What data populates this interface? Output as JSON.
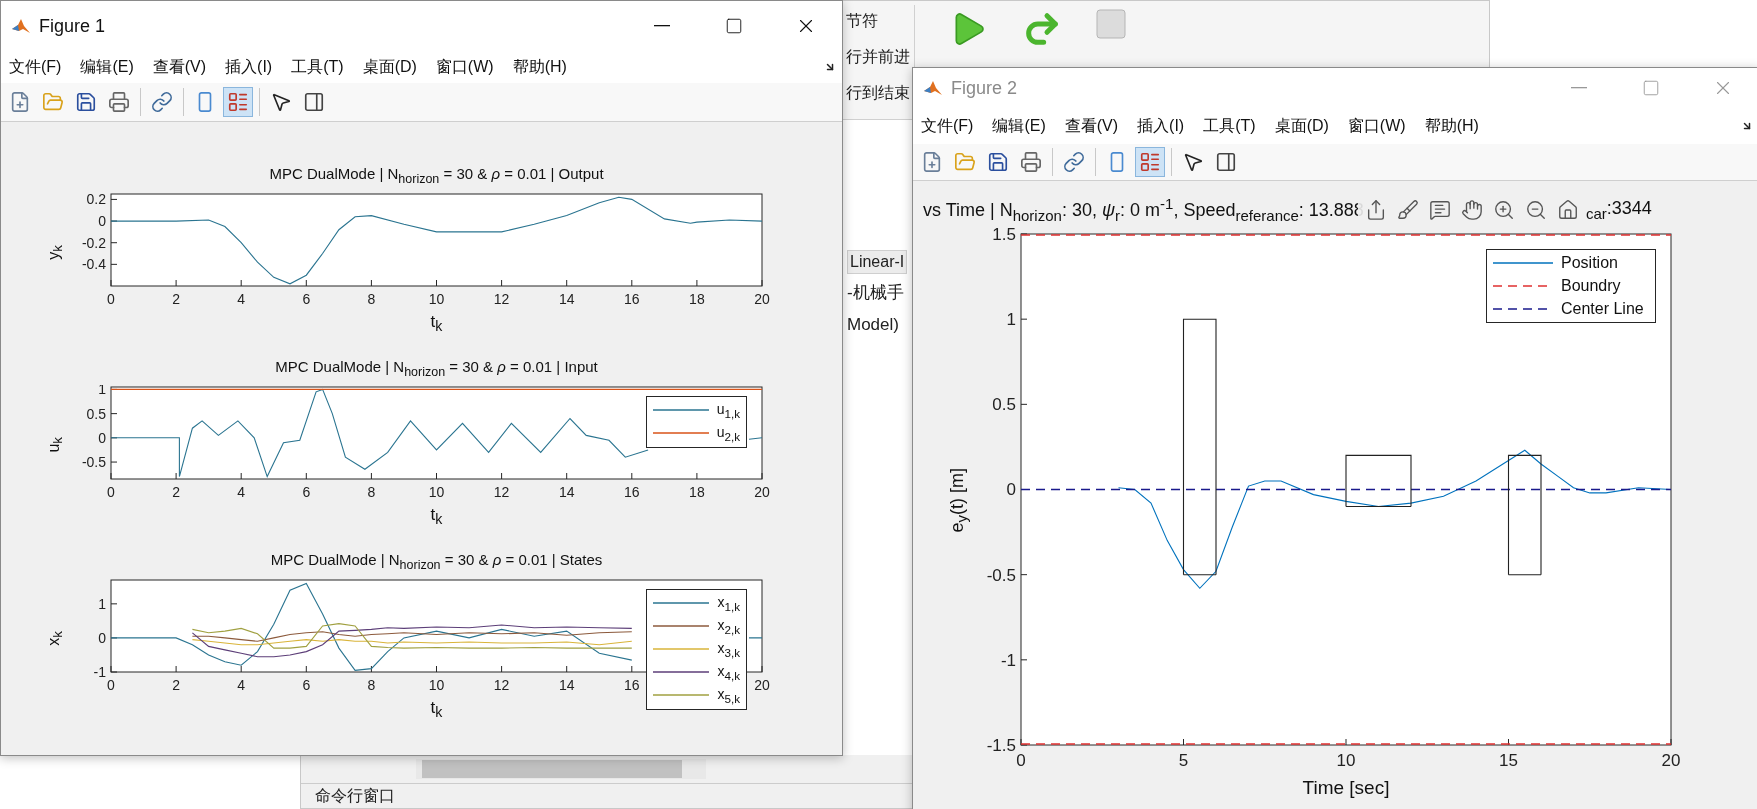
{
  "background_window": {
    "toolstrip_items": [
      "节符",
      "行并前进",
      "行到结束"
    ],
    "editor_tab": "Linear-I",
    "editor_lines": [
      "-机械手",
      "Model)"
    ],
    "command_window_title": "命令行窗口"
  },
  "figure_1": {
    "title": "Figure 1",
    "active": true,
    "menu": [
      "文件(F)",
      "编辑(E)",
      "查看(V)",
      "插入(I)",
      "工具(T)",
      "桌面(D)",
      "窗口(W)",
      "帮助(H)"
    ],
    "toolbar": [
      {
        "kind": "new",
        "selected": false
      },
      {
        "kind": "open",
        "selected": false
      },
      {
        "kind": "save",
        "selected": false
      },
      {
        "kind": "print",
        "selected": false
      },
      {
        "kind": "separator"
      },
      {
        "kind": "link",
        "selected": false
      },
      {
        "kind": "separator"
      },
      {
        "kind": "colorbar",
        "selected": false
      },
      {
        "kind": "legend",
        "selected": true
      },
      {
        "kind": "separator"
      },
      {
        "kind": "pointer",
        "selected": false
      },
      {
        "kind": "inspector",
        "selected": false
      }
    ],
    "plots": [
      {
        "chart_data": {
          "type": "line",
          "title": "MPC DualMode | N$_{horizon}$ = 30 & *ρ* = 0.01 | Output",
          "xlabel": "t$_{k}$",
          "ylabel": "y$_{k}$",
          "xlim": [
            0,
            20
          ],
          "ylim": [
            -0.6,
            0.25
          ],
          "xticks": [
            0,
            2,
            4,
            6,
            8,
            10,
            12,
            14,
            16,
            18,
            20
          ],
          "yticks": [
            -0.4,
            -0.2,
            0,
            0.2
          ],
          "x": [
            0,
            1,
            2,
            3,
            3.5,
            4,
            4.5,
            5,
            5.5,
            6,
            6.5,
            7,
            7.5,
            8,
            9,
            10,
            11,
            12,
            13,
            14,
            15,
            15.6,
            16,
            17,
            17.8,
            18,
            19,
            20
          ],
          "series": [
            {
              "color": "#2a7490",
              "values": [
                0,
                0,
                0,
                0.01,
                -0.05,
                -0.2,
                -0.38,
                -0.52,
                -0.58,
                -0.5,
                -0.3,
                -0.08,
                0.04,
                0.05,
                -0.03,
                -0.1,
                -0.1,
                -0.1,
                -0.03,
                0.05,
                0.17,
                0.22,
                0.2,
                0.02,
                -0.02,
                -0.01,
                0.01,
                0
              ]
            }
          ]
        }
      },
      {
        "chart_data": {
          "type": "line",
          "title": "MPC DualMode | N$_{horizon}$ = 30 & *ρ* = 0.01 | Input",
          "xlabel": "t$_{k}$",
          "ylabel": "u$_{k}$",
          "xlim": [
            0,
            20
          ],
          "ylim": [
            -0.85,
            1.05
          ],
          "xticks": [
            0,
            2,
            4,
            6,
            8,
            10,
            12,
            14,
            16,
            18,
            20
          ],
          "yticks": [
            -0.5,
            0,
            0.5,
            1
          ],
          "x": [
            0,
            2.1,
            2.1,
            2.5,
            2.8,
            3.3,
            3.9,
            4.4,
            4.8,
            5.3,
            5.8,
            6.3,
            6.5,
            6.8,
            7.2,
            7.8,
            8.5,
            9.2,
            10,
            10.8,
            11.6,
            12.3,
            13.2,
            14.1,
            14.6,
            15.3,
            15.8,
            16.5,
            17.5,
            19.6,
            20
          ],
          "series": [
            {
              "name": "u$_{1,k}$",
              "color": "#2a7490",
              "values": [
                0,
                0,
                -0.8,
                0.2,
                0.35,
                0.05,
                0.35,
                0,
                -0.8,
                -0.1,
                -0.05,
                0.95,
                1,
                0.5,
                -0.4,
                -0.65,
                -0.3,
                0.35,
                -0.25,
                0.3,
                -0.3,
                0.3,
                -0.3,
                0.4,
                0.05,
                -0.05,
                -0.4,
                -0.25,
                null,
                -0.03,
                0
              ]
            },
            {
              "name": "u$_{2,k}$",
              "color": "#d95319",
              "values": [
                1,
                1,
                1,
                1,
                1,
                1,
                1,
                1,
                1,
                1,
                1,
                1,
                1,
                1,
                1,
                1,
                1,
                1,
                1,
                1,
                1,
                1,
                1,
                1,
                1,
                1,
                1,
                1,
                1,
                1,
                1
              ]
            }
          ]
        }
      },
      {
        "chart_data": {
          "type": "line",
          "title": "MPC DualMode | N$_{horizon}$ = 30 & *ρ* = 0.01 | States",
          "xlabel": "t$_{k}$",
          "ylabel": "x$_{k}$",
          "xlim": [
            0,
            20
          ],
          "ylim": [
            -1,
            1.7
          ],
          "xticks": [
            0,
            2,
            4,
            6,
            8,
            10,
            12,
            14,
            16,
            20
          ],
          "yticks": [
            -1,
            0,
            1
          ],
          "x": [
            0,
            2,
            2.5,
            3,
            3.5,
            4,
            4.5,
            5,
            5.5,
            6,
            6.5,
            7,
            7.5,
            8,
            8.5,
            9,
            10,
            11,
            12,
            13,
            14,
            15,
            16,
            17,
            18,
            19.6,
            20
          ],
          "series": [
            {
              "name": "x$_{1,k}$",
              "color": "#2a7490",
              "values": [
                0,
                0,
                -0.2,
                -0.5,
                -0.7,
                -0.8,
                -0.4,
                0.4,
                1.4,
                1.6,
                0.7,
                -0.3,
                -0.95,
                -0.9,
                -0.4,
                0,
                0.2,
                0,
                0.25,
                0.05,
                0.2,
                -0.45,
                -0.65,
                null,
                null,
                0,
                0
              ]
            },
            {
              "name": "x$_{2,k}$",
              "color": "#8c5a3c",
              "values": [
                null,
                null,
                0.05,
                0.05,
                0,
                -0.05,
                -0.1,
                0,
                0.1,
                0.15,
                0.18,
                0.1,
                0.05,
                0.1,
                0.12,
                0.15,
                0.1,
                0.15,
                0.12,
                0.15,
                0.08,
                0.15,
                0.18,
                null,
                null,
                null,
                null
              ]
            },
            {
              "name": "x$_{3,k}$",
              "color": "#d9b43a",
              "values": [
                null,
                null,
                -0.05,
                -0.1,
                -0.15,
                -0.2,
                -0.2,
                -0.15,
                -0.1,
                -0.05,
                -0.1,
                -0.05,
                -0.1,
                -0.1,
                -0.15,
                -0.12,
                -0.15,
                -0.12,
                -0.15,
                -0.15,
                -0.12,
                -0.2,
                -0.1,
                null,
                null,
                null,
                null
              ]
            },
            {
              "name": "x$_{4,k}$",
              "color": "#5c3e78",
              "values": [
                null,
                null,
                0.15,
                -0.25,
                -0.35,
                -0.45,
                -0.55,
                -0.55,
                -0.5,
                -0.4,
                -0.2,
                0.2,
                0.22,
                0.25,
                0.3,
                0.28,
                0.32,
                0.3,
                0.38,
                0.3,
                0.32,
                0.3,
                0.28,
                null,
                null,
                null,
                null
              ]
            },
            {
              "name": "x$_{5,k}$",
              "color": "#a0a040",
              "values": [
                null,
                null,
                0.25,
                0.15,
                0.2,
                0.28,
                0.12,
                -0.3,
                -0.3,
                -0.25,
                0.35,
                0.42,
                0.35,
                -0.25,
                -0.28,
                -0.3,
                -0.28,
                -0.3,
                -0.3,
                -0.28,
                -0.3,
                -0.3,
                -0.3,
                null,
                null,
                null,
                null
              ]
            }
          ]
        }
      }
    ]
  },
  "figure_2": {
    "title": "Figure 2",
    "active": false,
    "menu": [
      "文件(F)",
      "编辑(E)",
      "查看(V)",
      "插入(I)",
      "工具(T)",
      "桌面(D)",
      "窗口(W)",
      "帮助(H)"
    ],
    "toolbar": [
      {
        "kind": "new",
        "selected": false
      },
      {
        "kind": "open",
        "selected": false
      },
      {
        "kind": "save",
        "selected": false
      },
      {
        "kind": "print",
        "selected": false
      },
      {
        "kind": "separator"
      },
      {
        "kind": "link",
        "selected": false
      },
      {
        "kind": "separator"
      },
      {
        "kind": "colorbar",
        "selected": false
      },
      {
        "kind": "legend",
        "selected": true
      },
      {
        "kind": "separator"
      },
      {
        "kind": "pointer",
        "selected": false
      },
      {
        "kind": "inspector",
        "selected": false
      }
    ],
    "title_left": "vs Time | N$_{horizon}$: 30, *ψ*$_{r}$: 0 m$^{-1}$, Speed$_{referance}$: 13.888",
    "title_right": "$_{car}$:3344",
    "axes_toolbar": [
      {
        "kind": "export"
      },
      {
        "kind": "brush"
      },
      {
        "kind": "datatip"
      },
      {
        "kind": "pan"
      },
      {
        "kind": "zoom-in"
      },
      {
        "kind": "zoom-out"
      },
      {
        "kind": "home"
      }
    ],
    "plot": {
      "chart_data": {
        "type": "line",
        "xlabel": "Time [sec]",
        "ylabel": "e$_{y}$(t) [m]",
        "xlim": [
          0,
          20
        ],
        "ylim": [
          -1.5,
          1.5
        ],
        "xticks": [
          0,
          5,
          10,
          15,
          20
        ],
        "yticks": [
          -1.5,
          -1,
          -0.5,
          0,
          0.5,
          1,
          1.5
        ],
        "x": [
          0,
          1,
          2,
          3,
          3.5,
          4,
          4.5,
          5,
          5,
          5.5,
          6,
          6,
          6.5,
          7,
          7.5,
          8,
          9,
          10,
          10,
          11,
          12,
          12,
          13,
          14,
          15,
          15,
          15.5,
          16,
          16,
          16.5,
          17,
          17.5,
          18,
          19,
          20
        ],
        "series": [
          {
            "name": "Position",
            "color": "#0072bd",
            "line_style": "solid",
            "values": [
              null,
              null,
              null,
              0.01,
              0,
              -0.08,
              -0.3,
              -0.47,
              -0.47,
              -0.58,
              -0.48,
              -0.48,
              -0.22,
              0.02,
              0.05,
              0.05,
              -0.03,
              -0.07,
              -0.07,
              -0.1,
              -0.08,
              -0.08,
              -0.04,
              0.05,
              0.17,
              0.17,
              0.23,
              0.15,
              0.15,
              0.08,
              0.01,
              -0.02,
              -0.02,
              0.01,
              0
            ]
          },
          {
            "name": "Boundry",
            "color": "#e03030",
            "line_style": "dashed",
            "values": [
              1.5,
              1.5,
              1.5,
              1.5,
              1.5,
              1.5,
              1.5,
              1.5,
              1.5,
              1.5,
              1.5,
              1.5,
              1.5,
              1.5,
              1.5,
              1.5,
              1.5,
              1.5,
              1.5,
              1.5,
              1.5,
              1.5,
              1.5,
              1.5,
              1.5,
              1.5,
              1.5,
              1.5,
              1.5,
              1.5,
              1.5,
              1.5,
              1.5,
              1.5,
              1.5
            ]
          },
          {
            "name": "Center Line",
            "color": "#1a1a8c",
            "line_style": "dashed",
            "values": [
              0,
              0,
              0,
              0,
              0,
              0,
              0,
              0,
              0,
              0,
              0,
              0,
              0,
              0,
              0,
              0,
              0,
              0,
              0,
              0,
              0,
              0,
              0,
              0,
              0,
              0,
              0,
              0,
              0,
              0,
              0,
              0,
              0,
              0,
              0
            ]
          },
          {
            "color": "#222222",
            "line_style": "solid",
            "values": [
              null,
              null,
              null,
              null,
              null,
              null,
              null,
              -0.5,
              1,
              1,
              1,
              -0.5,
              null,
              null,
              null,
              null,
              null,
              null,
              null,
              null,
              null,
              null,
              null,
              null,
              null,
              null,
              null,
              null,
              null,
              null,
              null,
              null,
              null,
              null,
              null
            ]
          },
          {
            "color": "#222222",
            "line_style": "solid",
            "values": [
              null,
              null,
              null,
              null,
              null,
              null,
              null,
              -0.5,
              -0.5,
              -0.5,
              -0.5,
              -0.5,
              null,
              null,
              null,
              null,
              null,
              null,
              null,
              null,
              null,
              null,
              null,
              null,
              null,
              null,
              null,
              null,
              null,
              null,
              null,
              null,
              null,
              null,
              null
            ]
          },
          {
            "color": "#222222",
            "line_style": "solid",
            "values": [
              null,
              null,
              null,
              null,
              null,
              null,
              null,
              null,
              null,
              null,
              null,
              null,
              null,
              null,
              null,
              null,
              null,
              -0.1,
              0.2,
              0.2,
              0.2,
              -0.1,
              null,
              null,
              null,
              null,
              null,
              null,
              null,
              null,
              null,
              null,
              null,
              null,
              null
            ]
          },
          {
            "color": "#222222",
            "line_style": "solid",
            "values": [
              null,
              null,
              null,
              null,
              null,
              null,
              null,
              null,
              null,
              null,
              null,
              null,
              null,
              null,
              null,
              null,
              null,
              -0.1,
              -0.1,
              -0.1,
              -0.1,
              -0.1,
              null,
              null,
              null,
              null,
              null,
              null,
              null,
              null,
              null,
              null,
              null,
              null,
              null
            ]
          },
          {
            "color": "#222222",
            "line_style": "solid",
            "values": [
              null,
              null,
              null,
              null,
              null,
              null,
              null,
              null,
              null,
              null,
              null,
              null,
              null,
              null,
              null,
              null,
              null,
              null,
              null,
              null,
              null,
              null,
              null,
              null,
              -0.5,
              0.2,
              0.2,
              0.2,
              -0.5,
              null,
              null,
              null,
              null,
              null,
              null
            ]
          },
          {
            "color": "#222222",
            "line_style": "solid",
            "values": [
              null,
              null,
              null,
              null,
              null,
              null,
              null,
              null,
              null,
              null,
              null,
              null,
              null,
              null,
              null,
              null,
              null,
              null,
              null,
              null,
              null,
              null,
              null,
              null,
              -0.5,
              -0.5,
              -0.5,
              -0.5,
              -0.5,
              null,
              null,
              null,
              null,
              null,
              null
            ]
          }
        ],
        "ref_lines": [
          {
            "axis": "y",
            "value": -1.5,
            "color": "#e03030",
            "line_style": "dashed"
          }
        ]
      }
    }
  }
}
